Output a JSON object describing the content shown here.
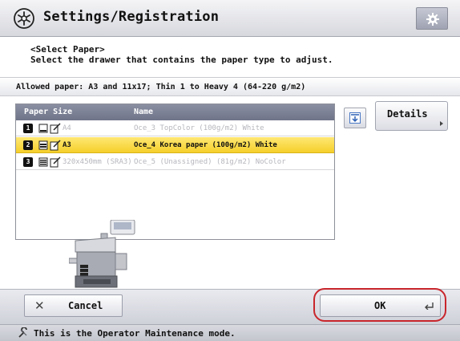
{
  "window": {
    "title": "Settings/Registration"
  },
  "instructions": {
    "line1": "<Select Paper>",
    "line2": "Select the drawer that contains the paper type to adjust."
  },
  "allowed_paper": "Allowed paper: A3 and 11x17; Thin 1 to Heavy 4 (64-220 g/m2)",
  "table": {
    "headers": {
      "paper_size": "Paper Size",
      "name": "Name"
    },
    "rows": [
      {
        "num": "1",
        "size": "A4",
        "name": "Oce_3 TopColor (100g/m2) White",
        "state": "disabled"
      },
      {
        "num": "2",
        "size": "A3",
        "name": "Oce_4 Korea paper (100g/m2) White",
        "state": "selected"
      },
      {
        "num": "3",
        "size": "320x450mm (SRA3)",
        "name": "Oce_5 (Unassigned) (81g/m2) NoColor",
        "state": "disabled"
      }
    ]
  },
  "buttons": {
    "details": "Details",
    "cancel": "Cancel",
    "ok": "OK"
  },
  "icons": {
    "title": "settings-registration-icon",
    "gear": "gear-icon",
    "scroll": "scroll-down-icon",
    "cancel": "close-icon",
    "ok": "enter-icon",
    "status": "wrench-icon"
  },
  "colors": {
    "selected_row": "#f5cf2a",
    "highlight_ring": "#c8262c",
    "table_header": "#7c8196"
  },
  "status_text": "This is the Operator Maintenance mode."
}
